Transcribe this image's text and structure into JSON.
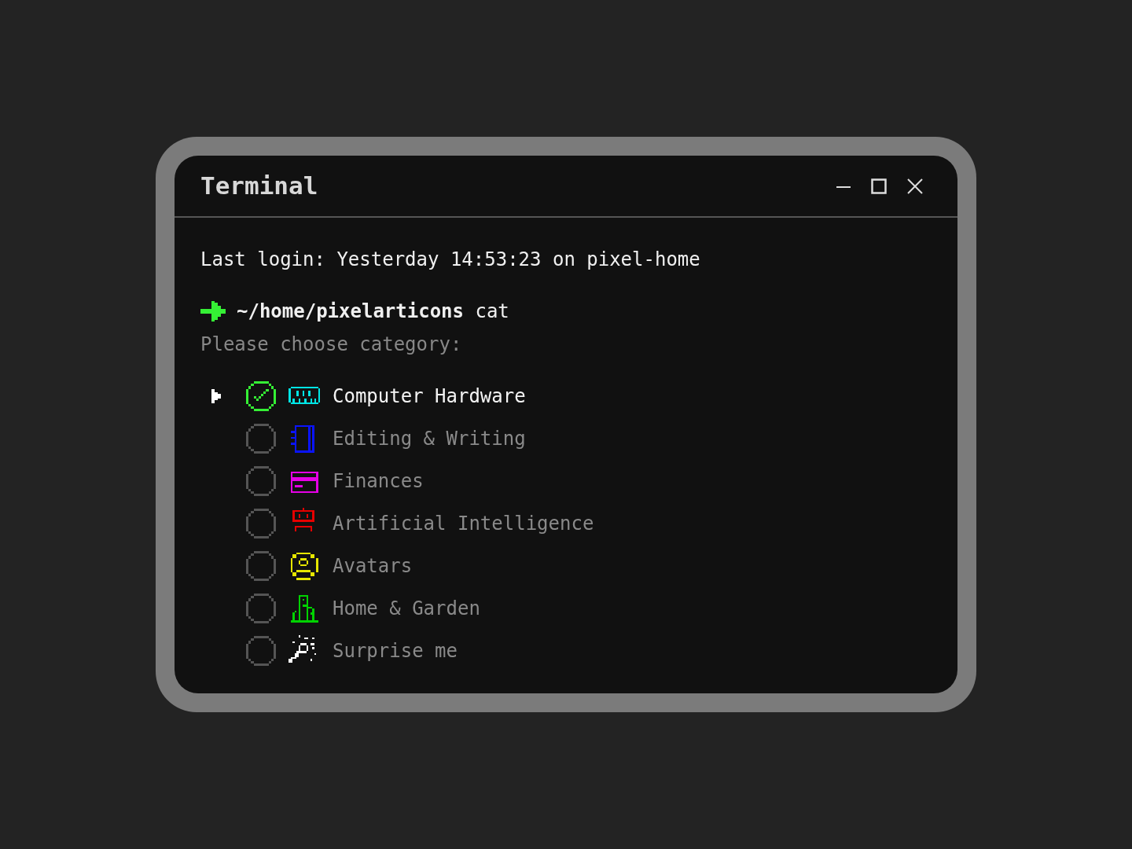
{
  "window": {
    "title": "Terminal"
  },
  "login_line": "Last login: Yesterday 14:53:23 on pixel-home",
  "prompt": {
    "path": "~/home/pixelarticons",
    "command": "cat"
  },
  "question": "Please choose category:",
  "options": [
    {
      "label": "Computer Hardware",
      "selected": true,
      "checked": true,
      "color": "#00e5e5"
    },
    {
      "label": "Editing & Writing",
      "selected": false,
      "checked": false,
      "color": "#0a14ff"
    },
    {
      "label": "Finances",
      "selected": false,
      "checked": false,
      "color": "#e600e6"
    },
    {
      "label": "Artificial Intelligence",
      "selected": false,
      "checked": false,
      "color": "#e60000"
    },
    {
      "label": "Avatars",
      "selected": false,
      "checked": false,
      "color": "#e6e600"
    },
    {
      "label": "Home & Garden",
      "selected": false,
      "checked": false,
      "color": "#00d200"
    },
    {
      "label": "Surprise me",
      "selected": false,
      "checked": false,
      "color": "#ffffff"
    }
  ]
}
